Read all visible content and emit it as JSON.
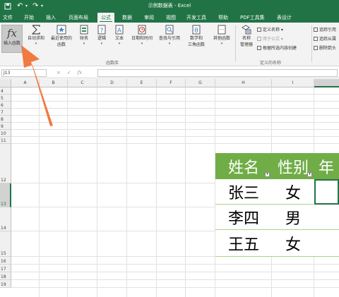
{
  "window": {
    "title": "示例数据表 - Excel"
  },
  "quick_access": {
    "save_icon": "save-icon",
    "undo_icon": "undo-icon",
    "redo_icon": "redo-icon"
  },
  "tabs": [
    {
      "label": "文件"
    },
    {
      "label": "开始"
    },
    {
      "label": "插入"
    },
    {
      "label": "页面布局"
    },
    {
      "label": "公式"
    },
    {
      "label": "数据"
    },
    {
      "label": "审阅"
    },
    {
      "label": "视图"
    },
    {
      "label": "开发工具"
    },
    {
      "label": "帮助"
    },
    {
      "label": "PDF工具集"
    },
    {
      "label": "表设计"
    }
  ],
  "active_tab_index": 4,
  "ribbon": {
    "insert_function": {
      "glyph": "fx",
      "label": "插入函数"
    },
    "buttons": [
      {
        "label": "自动求和",
        "icon": "sigma-icon"
      },
      {
        "label": "最近使用的",
        "label2": "函数",
        "icon": "star-icon"
      },
      {
        "label": "财务",
        "icon": "finance-book-icon"
      },
      {
        "label": "逻辑",
        "icon": "logic-question-icon"
      },
      {
        "label": "文本",
        "icon": "text-a-icon"
      },
      {
        "label": "日期和时间",
        "icon": "clock-icon"
      },
      {
        "label": "查找与引用",
        "icon": "lookup-icon"
      },
      {
        "label": "数学和",
        "label2": "三角函数",
        "icon": "theta-icon"
      },
      {
        "label": "其他函数",
        "icon": "more-functions-icon"
      },
      {
        "label": "名称",
        "label2": "管理器",
        "icon": "name-manager-icon"
      }
    ],
    "group_function_library": "函数库",
    "group_defined_names": "定义的名称",
    "defined_names": [
      {
        "label": "定义名称",
        "disabled": false
      },
      {
        "label": "用于公式",
        "disabled": true
      },
      {
        "label": "根据所选内容创建",
        "disabled": false
      }
    ],
    "auditing": [
      {
        "label": "追踪引用"
      },
      {
        "label": "追踪从属"
      },
      {
        "label": "删除箭头"
      }
    ]
  },
  "formula_bar": {
    "name_box": "J13",
    "cancel": "×",
    "confirm": "✓",
    "fx": "fx",
    "value": ""
  },
  "columns": [
    "A",
    "B",
    "C",
    "D",
    "E",
    "F",
    "G",
    "H",
    "I",
    "J"
  ],
  "selected_column": "J",
  "rows": [
    "4",
    "5",
    "6",
    "7",
    "8",
    "9",
    "10",
    "11",
    "12",
    "13",
    "14",
    "15",
    "16",
    "17",
    "18",
    "19"
  ],
  "selected_row": "13",
  "table": {
    "headers": [
      "姓名",
      "性别",
      "年"
    ],
    "rows": [
      [
        "张三",
        "女",
        ""
      ],
      [
        "李四",
        "男",
        ""
      ],
      [
        "王五",
        "女",
        ""
      ]
    ],
    "header_color": "#70ad47",
    "border_color": "#a9d18e"
  },
  "annotation": {
    "arrow_color": "#f06d2f"
  }
}
